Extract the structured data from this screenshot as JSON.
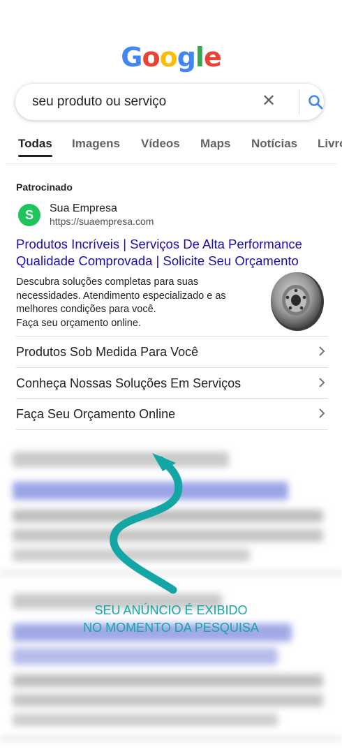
{
  "logo": {
    "letters": [
      "G",
      "o",
      "o",
      "g",
      "l",
      "e"
    ],
    "colors": [
      "#4285F4",
      "#EA4335",
      "#FBBC05",
      "#4285F4",
      "#34A853",
      "#EA4335"
    ]
  },
  "search": {
    "query": "seu produto ou serviço",
    "clear_symbol": "✕"
  },
  "tabs": [
    {
      "label": "Todas",
      "active": true
    },
    {
      "label": "Imagens",
      "active": false
    },
    {
      "label": "Vídeos",
      "active": false
    },
    {
      "label": "Maps",
      "active": false
    },
    {
      "label": "Notícias",
      "active": false
    },
    {
      "label": "Livros",
      "active": false
    }
  ],
  "ad": {
    "sponsored_label": "Patrocinado",
    "favicon_letter": "S",
    "company": "Sua Empresa",
    "url": "https://suaempresa.com",
    "title_line1": "Produtos Incríveis | Serviços De Alta Performance",
    "title_line2": "Qualidade Comprovada | Solicite Seu Orçamento",
    "description": [
      "Descubra soluções completas para suas",
      "necessidades. Atendimento especializado e as",
      "melhores condições para você.",
      "Faça seu orçamento online."
    ],
    "image_icon": "brake-disc",
    "sitelinks": [
      "Produtos Sob Medida Para Você",
      "Conheça Nossas Soluções Em Serviços",
      "Faça Seu Orçamento Online"
    ]
  },
  "callout": {
    "line1": "SEU ANÚNCIO É EXIBIDO",
    "line2": "NO MOMENTO DA PESQUISA"
  },
  "colors": {
    "link": "#1a0dab",
    "accent": "#14a6a4",
    "favicon": "#1fc55a"
  }
}
